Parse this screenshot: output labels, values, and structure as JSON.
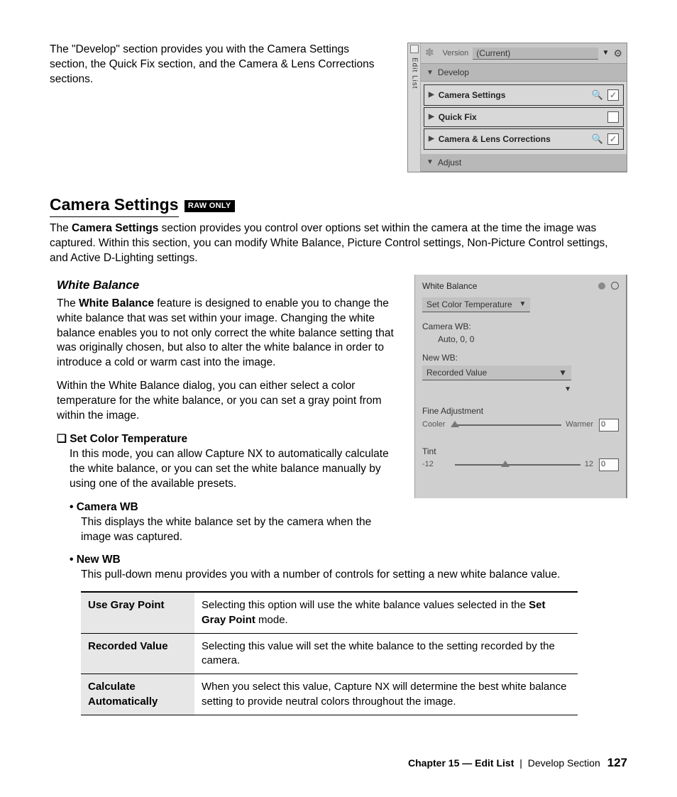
{
  "intro": "The \"Develop\" section provides you with the Camera Settings section, the Quick Fix section, and the Camera & Lens Corrections sections.",
  "editlist": {
    "side_label": "Edit List",
    "version_label": "Version",
    "version_value": "(Current)",
    "develop_label": "Develop",
    "rows": [
      {
        "label": "Camera Settings",
        "eye": true,
        "checked": true
      },
      {
        "label": "Quick Fix",
        "eye": false,
        "checked": false
      },
      {
        "label": "Camera & Lens Corrections",
        "eye": true,
        "checked": true
      }
    ],
    "adjust_label": "Adjust"
  },
  "heading": "Camera Settings",
  "raw_badge": "RAW ONLY",
  "cs_intro_pre": "The ",
  "cs_intro_bold": "Camera Settings",
  "cs_intro_post": " section provides you control over options set within the camera at the time the image was captured. Within this section, you can modify White Balance, Picture Control settings, Non-Picture Control settings, and Active D-Lighting settings.",
  "wb_heading": "White Balance",
  "wb_para1_pre": "The ",
  "wb_para1_bold": "White Balance",
  "wb_para1_post": " feature is designed to enable you to change the white balance that was set within your image. Changing the white balance enables you to not only correct the white balance setting that was originally chosen, but also to alter the white balance in order to introduce a cold or warm cast into the image.",
  "wb_para2": "Within the White Balance dialog, you can either select a color temperature for the white balance, or you can set a gray point from within the image.",
  "set_ct_head": "Set Color Temperature",
  "set_ct_body": "In this mode, you can allow Capture NX to automatically calculate the white balance, or you can set the white balance manually by using one of the available presets.",
  "camera_wb_head": "Camera WB",
  "camera_wb_body": "This displays the white balance set by the camera when the image was captured.",
  "new_wb_head": "New WB",
  "new_wb_body": "This pull-down menu provides you with a number of controls for setting a new white balance value.",
  "wb_panel": {
    "title": "White Balance",
    "select1": "Set Color Temperature",
    "camerawb_label": "Camera WB:",
    "camerawb_value": "Auto, 0, 0",
    "newwb_label": "New WB:",
    "newwb_value": "Recorded Value",
    "fine_label": "Fine Adjustment",
    "cooler": "Cooler",
    "warmer": "Warmer",
    "fine_value": "0",
    "tint_label": "Tint",
    "tint_min": "-12",
    "tint_max": "12",
    "tint_value": "0"
  },
  "table": [
    {
      "k": "Use Gray Point",
      "v_pre": "Selecting this option will use the white balance values selected in the ",
      "v_bold": "Set Gray Point",
      "v_post": " mode."
    },
    {
      "k": "Recorded Value",
      "v_pre": "Selecting this value will set the white balance to the setting recorded by the camera.",
      "v_bold": "",
      "v_post": ""
    },
    {
      "k": "Calculate Automatically",
      "v_pre": "When you select this value, Capture NX will determine the best white balance setting to provide neutral colors throughout the image.",
      "v_bold": "",
      "v_post": ""
    }
  ],
  "footer": {
    "chapter": "Chapter 15 — Edit List",
    "section": "Develop Section",
    "page": "127"
  }
}
